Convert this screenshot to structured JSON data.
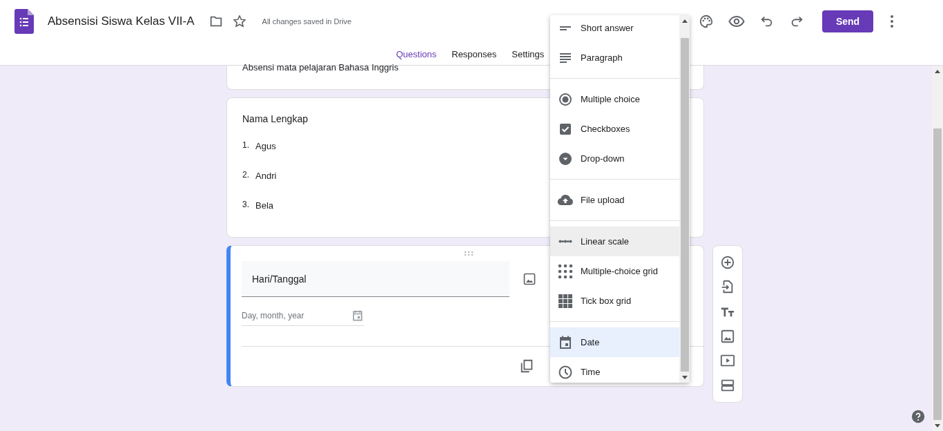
{
  "header": {
    "title": "Absensisi Siswa Kelas VII-A",
    "save_status": "All changes saved in Drive",
    "send_button": "Send"
  },
  "tabs": [
    {
      "label": "Questions",
      "selected": true
    },
    {
      "label": "Responses",
      "selected": false
    },
    {
      "label": "Settings",
      "selected": false
    }
  ],
  "description_card": {
    "text": "Absensi mata pelajaran Bahasa Inggris"
  },
  "question_card": {
    "title": "Nama Lengkap",
    "items": [
      {
        "number": "1.",
        "text": "Agus"
      },
      {
        "number": "2.",
        "text": "Andri"
      },
      {
        "number": "3.",
        "text": "Bela"
      }
    ]
  },
  "active_question": {
    "title": "Hari/Tanggal",
    "date_placeholder": "Day, month, year"
  },
  "type_menu": {
    "groups": [
      [
        {
          "kind": "short",
          "label": "Short answer",
          "hovered": false,
          "selected": false
        },
        {
          "kind": "paragraph",
          "label": "Paragraph",
          "hovered": false,
          "selected": false
        }
      ],
      [
        {
          "kind": "radio",
          "label": "Multiple choice",
          "hovered": false,
          "selected": false
        },
        {
          "kind": "checkbox",
          "label": "Checkboxes",
          "hovered": false,
          "selected": false
        },
        {
          "kind": "dropdown",
          "label": "Drop-down",
          "hovered": false,
          "selected": false
        }
      ],
      [
        {
          "kind": "upload",
          "label": "File upload",
          "hovered": false,
          "selected": false
        }
      ],
      [
        {
          "kind": "scale",
          "label": "Linear scale",
          "hovered": true,
          "selected": false
        },
        {
          "kind": "dotgrid",
          "label": "Multiple-choice grid",
          "hovered": false,
          "selected": false
        },
        {
          "kind": "boxgrid",
          "label": "Tick box grid",
          "hovered": false,
          "selected": false
        }
      ],
      [
        {
          "kind": "date",
          "label": "Date",
          "hovered": false,
          "selected": true
        },
        {
          "kind": "time",
          "label": "Time",
          "hovered": false,
          "selected": false
        }
      ]
    ]
  }
}
